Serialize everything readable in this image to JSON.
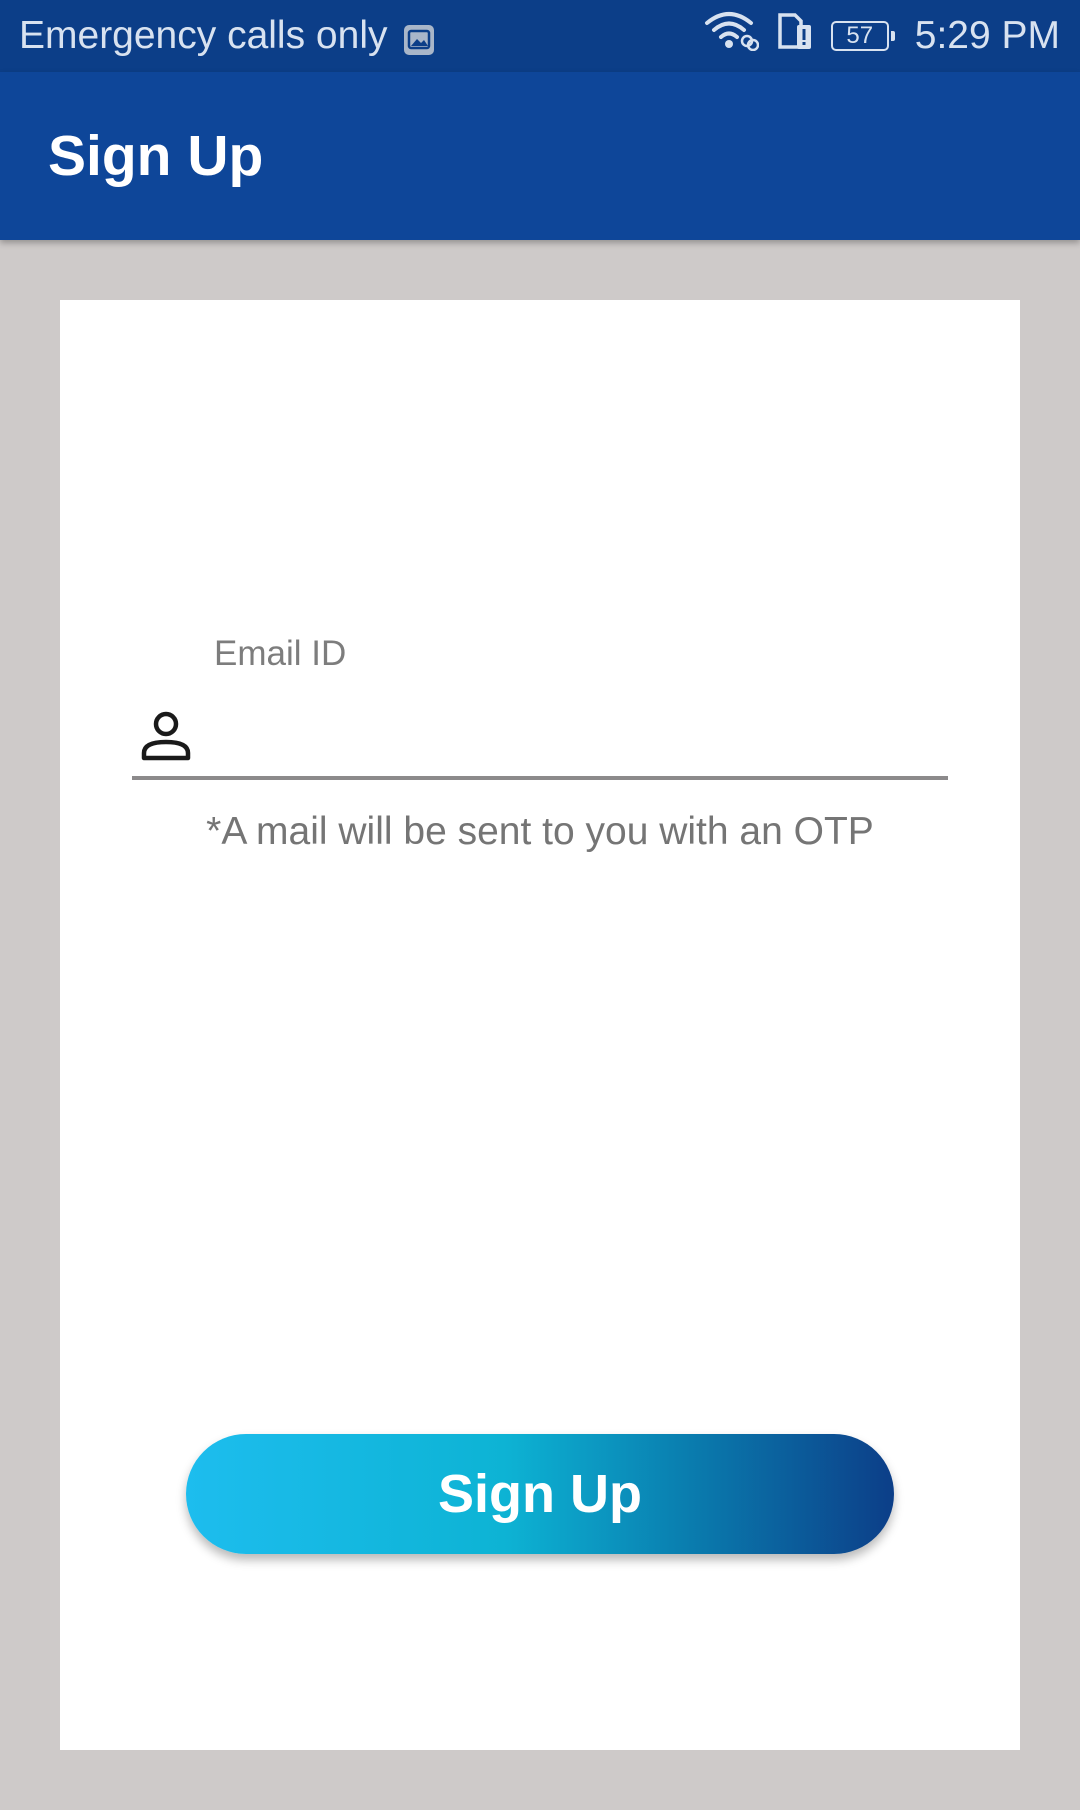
{
  "status_bar": {
    "carrier_text": "Emergency calls only",
    "battery_level": "57",
    "time": "5:29 PM",
    "icons": [
      "gallery-icon",
      "wifi-icon",
      "sim-alert-icon",
      "battery-icon"
    ]
  },
  "app_bar": {
    "title": "Sign Up"
  },
  "form": {
    "email_label": "Email ID",
    "email_value": "",
    "hint": "*A mail will be sent to you with an OTP",
    "submit_label": "Sign Up"
  },
  "colors": {
    "status_bar": "#0c3e88",
    "app_bar": "#0e4699",
    "background": "#cecac9",
    "card": "#ffffff",
    "button_gradient_start": "#1dbdee",
    "button_gradient_end": "#0c3e88"
  }
}
